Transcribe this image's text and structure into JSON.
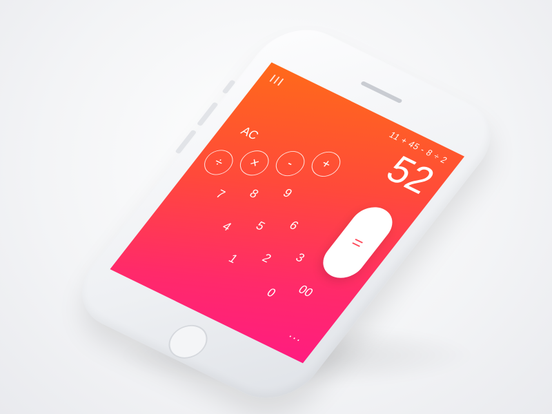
{
  "calculator": {
    "expression": "11 + 45 - 8 ÷ 2",
    "result": "52",
    "clear_label": "AC",
    "operators": [
      "÷",
      "×",
      "-",
      "+"
    ],
    "equals_label": "=",
    "more_label": "...",
    "keys": [
      "9",
      "8",
      "7",
      "6",
      "5",
      "4",
      "3",
      "2",
      "1",
      "0",
      "00"
    ]
  },
  "colors": {
    "gradient_start": "#ff6a1a",
    "gradient_end": "#ff1c80",
    "phone_body": "#eef0f3"
  }
}
